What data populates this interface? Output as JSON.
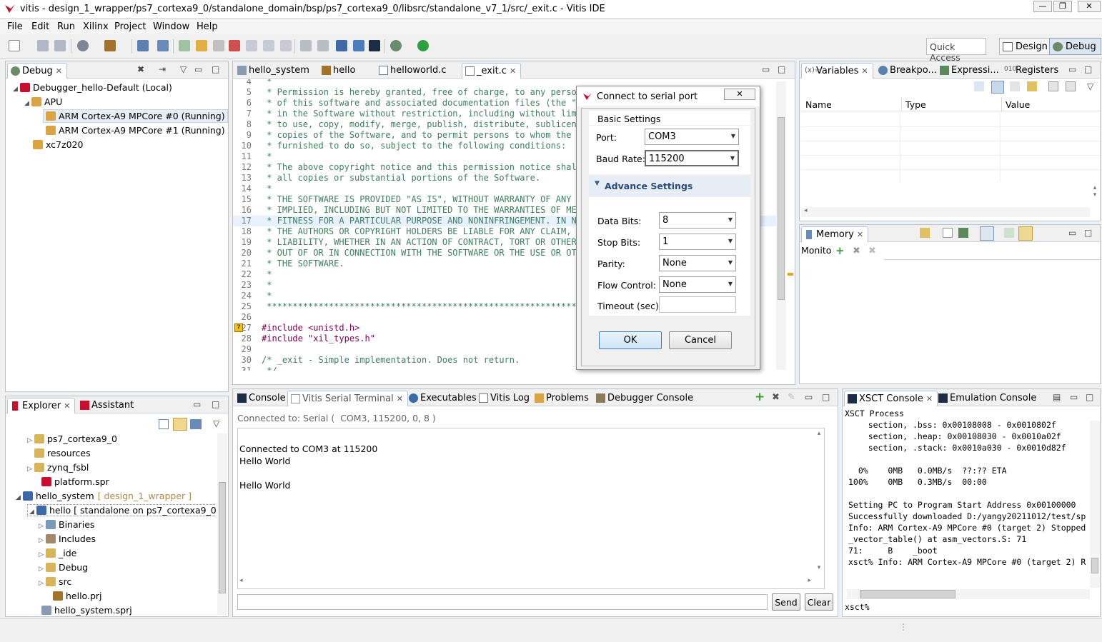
{
  "window": {
    "title": "vitis - design_1_wrapper/ps7_cortexa9_0/standalone_domain/bsp/ps7_cortexa9_0/libsrc/standalone_v7_1/src/_exit.c - Vitis IDE",
    "minimize": "—",
    "restore": "❐",
    "close": "✕"
  },
  "menu": [
    "File",
    "Edit",
    "Run",
    "Xilinx",
    "Project",
    "Window",
    "Help"
  ],
  "toolbar": {
    "quick_access": "Quick Access",
    "perspectives": [
      "Design",
      "Debug"
    ]
  },
  "debug_view": {
    "tab": "Debug",
    "tree": [
      {
        "label": "Debugger_hello-Default (Local)"
      },
      {
        "label": "APU"
      },
      {
        "label": "ARM Cortex-A9 MPCore #0 (Running)"
      },
      {
        "label": "ARM Cortex-A9 MPCore #1 (Running)"
      },
      {
        "label": "xc7z020"
      }
    ]
  },
  "editor": {
    "tabs": [
      "hello_system",
      "hello",
      "helloworld.c",
      "_exit.c"
    ],
    "lines": [
      {
        "n": "4",
        "t": " *"
      },
      {
        "n": "5",
        "t": " * Permission is hereby granted, free of charge, to any person o"
      },
      {
        "n": "6",
        "t": " * of this software and associated documentation files (the \"Sof"
      },
      {
        "n": "7",
        "t": " * in the Software without restriction, including without limita"
      },
      {
        "n": "8",
        "t": " * to use, copy, modify, merge, publish, distribute, sublicense,"
      },
      {
        "n": "9",
        "t": " * copies of the Software, and to permit persons to whom the Sof"
      },
      {
        "n": "10",
        "t": " * furnished to do so, subject to the following conditions:"
      },
      {
        "n": "11",
        "t": " *"
      },
      {
        "n": "12",
        "t": " * The above copyright notice and this permission notice shall b"
      },
      {
        "n": "13",
        "t": " * all copies or substantial portions of the Software."
      },
      {
        "n": "14",
        "t": " *"
      },
      {
        "n": "15",
        "t": " * THE SOFTWARE IS PROVIDED \"AS IS\", WITHOUT WARRANTY OF ANY KIN"
      },
      {
        "n": "16",
        "t": " * IMPLIED, INCLUDING BUT NOT LIMITED TO THE WARRANTIES OF MERCH"
      },
      {
        "n": "17",
        "t": " * FITNESS FOR A PARTICULAR PURPOSE AND NONINFRINGEMENT. IN NO E"
      },
      {
        "n": "18",
        "t": " * THE AUTHORS OR COPYRIGHT HOLDERS BE LIABLE FOR ANY CLAIM, DAM"
      },
      {
        "n": "19",
        "t": " * LIABILITY, WHETHER IN AN ACTION OF CONTRACT, TORT OR OTHERWIS"
      },
      {
        "n": "20",
        "t": " * OUT OF OR IN CONNECTION WITH THE SOFTWARE OR THE USE OR OTHER"
      },
      {
        "n": "21",
        "t": " * THE SOFTWARE."
      },
      {
        "n": "22",
        "t": " *"
      },
      {
        "n": "23",
        "t": " *"
      },
      {
        "n": "24",
        "t": " *"
      },
      {
        "n": "25",
        "t": " ******************************************************************"
      },
      {
        "n": "26",
        "t": ""
      },
      {
        "n": "27",
        "t": "#include <unistd.h>"
      },
      {
        "n": "28",
        "t": "#include \"xil_types.h\""
      },
      {
        "n": "29",
        "t": ""
      },
      {
        "n": "30",
        "t": "/* _exit - Simple implementation. Does not return."
      },
      {
        "n": "31",
        "t": " */"
      }
    ]
  },
  "dialog": {
    "title": "Connect to serial port",
    "basic_settings": "Basic Settings",
    "port_label": "Port:",
    "port_value": "COM3",
    "baud_label": "Baud Rate:",
    "baud_value": "115200",
    "advance_settings": "Advance Settings",
    "data_bits_label": "Data Bits:",
    "data_bits_value": "8",
    "stop_bits_label": "Stop Bits:",
    "stop_bits_value": "1",
    "parity_label": "Parity:",
    "parity_value": "None",
    "flow_label": "Flow Control:",
    "flow_value": "None",
    "timeout_label": "Timeout (sec):",
    "timeout_value": "",
    "ok": "OK",
    "cancel": "Cancel"
  },
  "variables_view": {
    "tabs": [
      "Variables",
      "Breakpo...",
      "Expressi...",
      "Registers"
    ],
    "columns": [
      "Name",
      "Type",
      "Value"
    ]
  },
  "memory_view": {
    "tab": "Memory",
    "monitors_label": "Monito"
  },
  "explorer_view": {
    "tabs": [
      "Explorer",
      "Assistant"
    ],
    "tree": [
      {
        "label": "ps7_cortexa9_0",
        "extra": ""
      },
      {
        "label": "resources",
        "extra": ""
      },
      {
        "label": "zynq_fsbl",
        "extra": ""
      },
      {
        "label": "platform.spr",
        "extra": ""
      },
      {
        "label": "hello_system",
        "extra": "[ design_1_wrapper ]"
      },
      {
        "label": "hello [ standalone on ps7_cortexa9_0 ]",
        "extra": ""
      },
      {
        "label": "Binaries",
        "extra": ""
      },
      {
        "label": "Includes",
        "extra": ""
      },
      {
        "label": "_ide",
        "extra": ""
      },
      {
        "label": "Debug",
        "extra": ""
      },
      {
        "label": "src",
        "extra": ""
      },
      {
        "label": "hello.prj",
        "extra": ""
      },
      {
        "label": "hello_system.sprj",
        "extra": ""
      }
    ]
  },
  "terminal_view": {
    "tabs": [
      "Console",
      "Vitis Serial Terminal",
      "Executables",
      "Vitis Log",
      "Problems",
      "Debugger Console"
    ],
    "status": "Connected to: Serial (  COM3, 115200, 0, 8 )",
    "output": [
      "Connected to COM3 at 115200",
      "Hello World",
      "",
      "Hello World"
    ],
    "input_value": "",
    "send": "Send",
    "clear": "Clear"
  },
  "xsct_view": {
    "tabs": [
      "XSCT Console",
      "Emulation Console"
    ],
    "header": "XSCT Process",
    "lines": [
      "    section, .bss: 0x00108008 - 0x0010802f",
      "    section, .heap: 0x00108030 - 0x0010a02f",
      "    section, .stack: 0x0010a030 - 0x0010d82f",
      "",
      "  0%    0MB   0.0MB/s  ??:?? ETA",
      "100%    0MB   0.3MB/s  00:00",
      "",
      "Setting PC to Program Start Address 0x00100000",
      "Successfully downloaded D:/yangy20211012/test/sp",
      "Info: ARM Cortex-A9 MPCore #0 (target 2) Stopped",
      "_vector_table() at asm_vectors.S: 71",
      "71:     B    _boot",
      "xsct% Info: ARM Cortex-A9 MPCore #0 (target 2) R"
    ],
    "prompt": "xsct%"
  },
  "colors": {
    "accent": "#3c78c8",
    "comment": "#3f7f5f",
    "keyword": "#7f0055",
    "string": "#2a00ff",
    "xilinx_red": "#c8102e"
  }
}
